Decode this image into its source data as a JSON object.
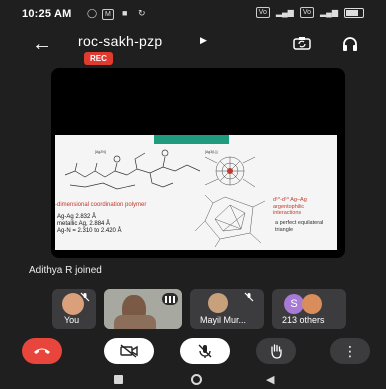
{
  "status_bar": {
    "time": "10:25 AM",
    "notif_1": "⌂",
    "notif_2": "M",
    "network_1": "VoLTE",
    "network_2": "VoLTE",
    "battery": "battery-icon"
  },
  "header": {
    "room_code": "roc-sakh-pzp",
    "rec_label": "REC"
  },
  "slide": {
    "polymer_label": "-dimensional coordination polymer",
    "stats": [
      "Ag-Ag 2.832 Å",
      "metallic Ag, 2.884 Å",
      "Ag-N = 2.310 to 2.420 Å"
    ],
    "interaction_label": "d¹⁰-d¹⁰ Ag–Ag argentophilic interactions",
    "triangle_label": "a perfect equilateral triangle"
  },
  "toast": {
    "text": "Adithya R joined"
  },
  "participants": {
    "you_label": "You",
    "mayil_label": "Mayil Mur...",
    "others_label": "213 others",
    "others_initial": "S"
  },
  "colors": {
    "end_call": "#e8453c",
    "control_bg": "#ffffff",
    "rec": "#e03b30",
    "teal": "#1f9c7d"
  }
}
